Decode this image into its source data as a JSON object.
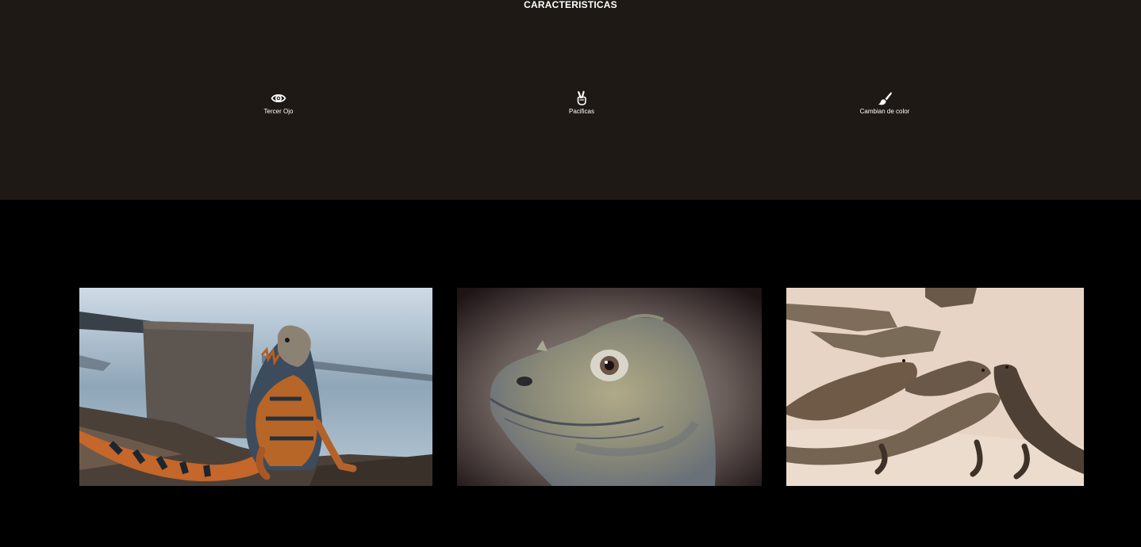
{
  "features": {
    "title": "CARACTERISTICAS",
    "items": [
      {
        "icon": "eye-icon",
        "label": "Tercer Ojo"
      },
      {
        "icon": "peace-hand-icon",
        "label": "Pacificas"
      },
      {
        "icon": "paint-brush-icon",
        "label": "Cambian de color"
      }
    ]
  },
  "gallery": {
    "photos": [
      {
        "subject": "orange and black iguana on rocks by the sea"
      },
      {
        "subject": "close-up of a grey iguana head"
      },
      {
        "subject": "group of iguanas on sand"
      }
    ]
  },
  "colors": {
    "features_background": "#1e1914",
    "gallery_background": "#000000",
    "text": "#ffffff"
  }
}
